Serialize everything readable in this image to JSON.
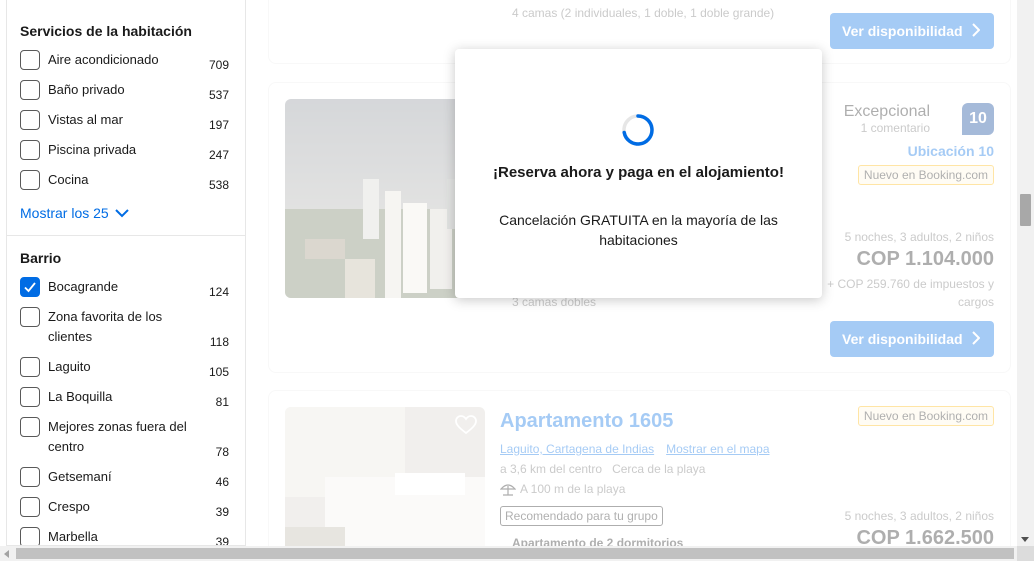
{
  "filters": {
    "room_services": {
      "title": "Servicios de la habitación",
      "items": [
        {
          "label": "Aire acondicionado",
          "count": "709",
          "checked": false
        },
        {
          "label": "Baño privado",
          "count": "537",
          "checked": false
        },
        {
          "label": "Vistas al mar",
          "count": "197",
          "checked": false
        },
        {
          "label": "Piscina privada",
          "count": "247",
          "checked": false
        },
        {
          "label": "Cocina",
          "count": "538",
          "checked": false
        }
      ],
      "show_more": "Mostrar los 25"
    },
    "neighborhood": {
      "title": "Barrio",
      "items": [
        {
          "label": "Bocagrande",
          "count": "124",
          "checked": true
        },
        {
          "label": "Zona favorita de los clientes",
          "count": "118",
          "checked": false
        },
        {
          "label": "Laguito",
          "count": "105",
          "checked": false
        },
        {
          "label": "La Boquilla",
          "count": "81",
          "checked": false
        },
        {
          "label": "Mejores zonas fuera del centro",
          "count": "78",
          "checked": false
        },
        {
          "label": "Getsemaní",
          "count": "46",
          "checked": false
        },
        {
          "label": "Crespo",
          "count": "39",
          "checked": false
        },
        {
          "label": "Marbella",
          "count": "39",
          "checked": false
        }
      ]
    }
  },
  "results": {
    "card1": {
      "beds": "4 camas (2 individuales, 1 doble, 1 doble grande)",
      "button": "Ver disponibilidad"
    },
    "card2": {
      "rating_word": "Excepcional",
      "reviews": "1 comentario",
      "score": "10",
      "location_score": "Ubicación 10",
      "new_badge": "Nuevo en Booking.com",
      "stay": "5 noches, 3 adultos, 2 niños",
      "price": "COP 1.104.000",
      "taxes": "+ COP 259.760 de impuestos y cargos",
      "beds": "3 camas dobles",
      "button": "Ver disponibilidad"
    },
    "card3": {
      "name": "Apartamento 1605",
      "location": "Laguito, Cartagena de Indias",
      "map_link": "Mostrar en el mapa",
      "distance": "a 3,6 km del centro",
      "beach": "Cerca de la playa",
      "beach_distance": "A 100 m de la playa",
      "recommended": "Recomendado para tu grupo",
      "unit_type": "Apartamento de 2 dormitorios",
      "new_badge": "Nuevo en Booking.com",
      "stay": "5 noches, 3 adultos, 2 niños",
      "price": "COP 1.662.500"
    }
  },
  "popup": {
    "title": "¡Reserva ahora y paga en el alojamiento!",
    "subtitle": "Cancelación GRATUITA en la mayoría de las habitaciones"
  },
  "colors": {
    "brand_blue": "#006ce4",
    "score_bg": "#003b95",
    "badge_yellow": "#ffb700"
  }
}
